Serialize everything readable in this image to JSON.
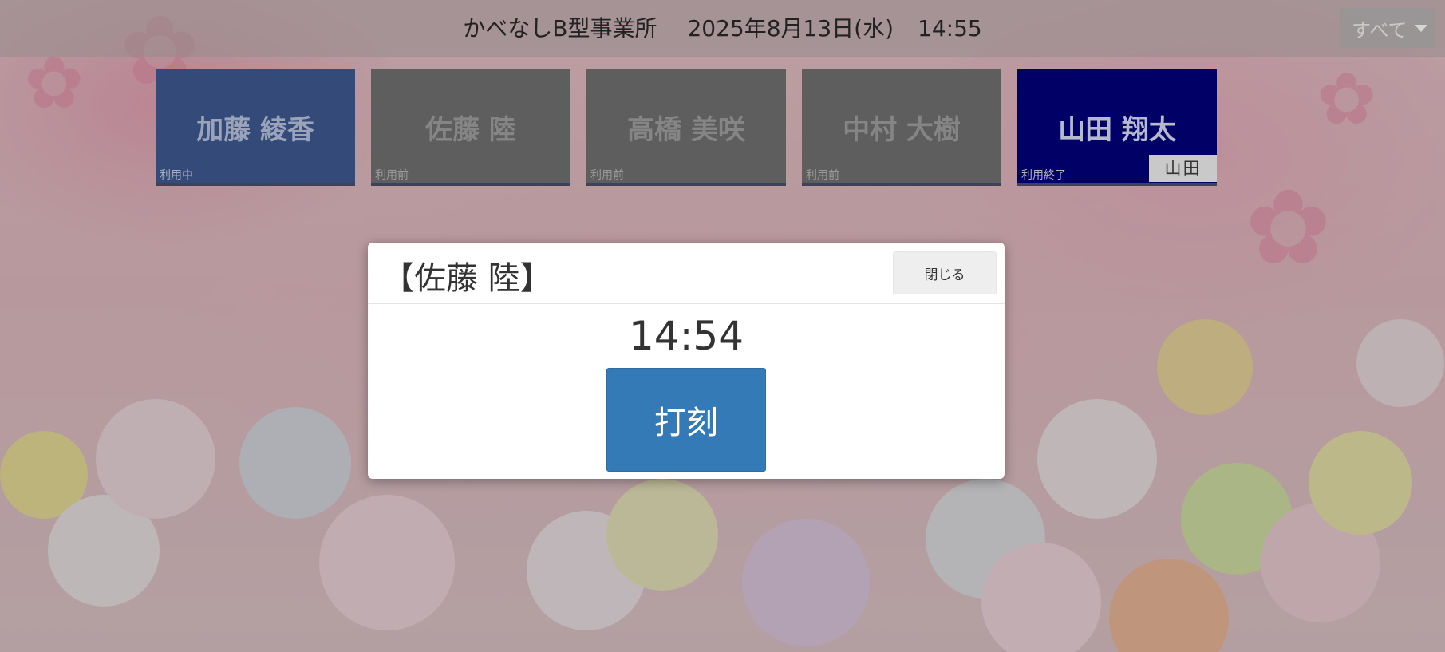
{
  "header": {
    "facility": "かべなしB型事業所",
    "date": "2025年8月13日(水)",
    "time": "14:55",
    "filter_label": "すべて"
  },
  "users": [
    {
      "name": "加藤 綾香",
      "status": "利用中"
    },
    {
      "name": "佐藤 陸",
      "status": "利用前"
    },
    {
      "name": "高橋 美咲",
      "status": "利用前"
    },
    {
      "name": "中村 大樹",
      "status": "利用前"
    },
    {
      "name": "山田 翔太",
      "status": "利用終了",
      "tag": "山田"
    }
  ],
  "modal": {
    "title": "【佐藤 陸】",
    "close_label": "閉じる",
    "time": "14:54",
    "stamp_label": "打刻"
  },
  "colors": {
    "active": "#344a78",
    "before": "#5e5e5e",
    "done": "#000066",
    "primary_button": "#337ab7"
  }
}
